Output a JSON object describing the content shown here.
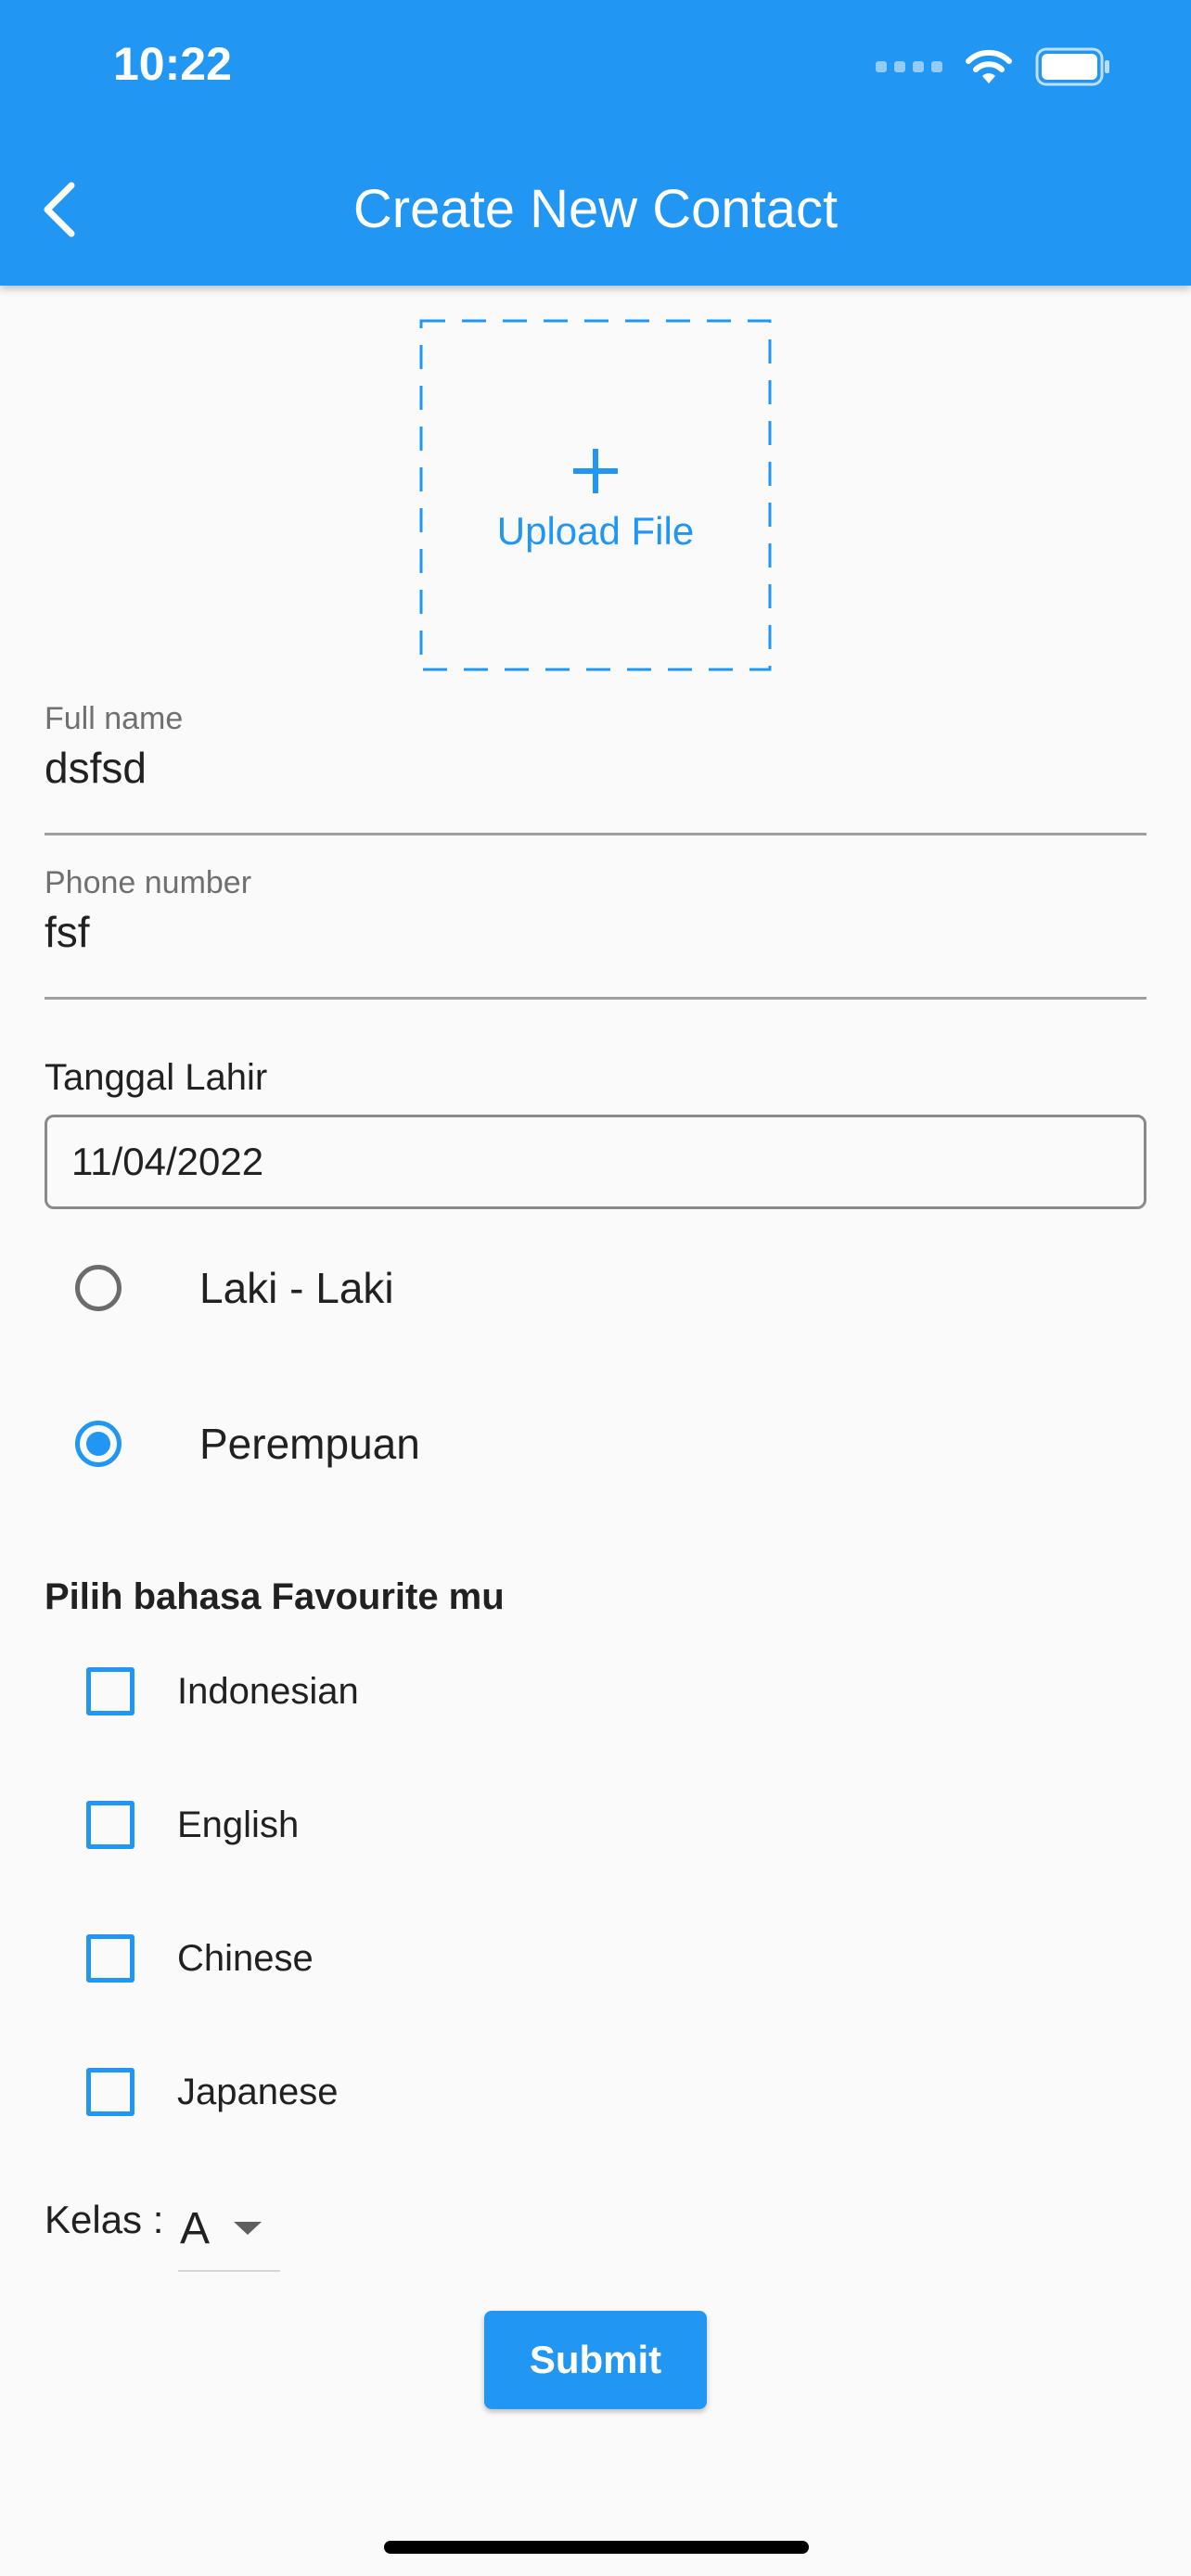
{
  "status_bar": {
    "time": "10:22",
    "icons": [
      "signal-icon",
      "wifi-icon",
      "battery-icon"
    ]
  },
  "app_bar": {
    "title": "Create New Contact",
    "back_icon": "chevron-left-icon",
    "color": "#2196F3"
  },
  "upload": {
    "icon": "plus-icon",
    "label": "Upload File"
  },
  "full_name": {
    "label": "Full name",
    "value": "dsfsd"
  },
  "phone_number": {
    "label": "Phone number",
    "value": "fsf"
  },
  "birth_date": {
    "label": "Tanggal Lahir",
    "value": "11/04/2022"
  },
  "gender": {
    "options": [
      {
        "label": "Laki - Laki",
        "selected": false
      },
      {
        "label": "Perempuan",
        "selected": true
      }
    ]
  },
  "languages": {
    "heading": "Pilih bahasa Favourite mu",
    "options": [
      {
        "label": "Indonesian",
        "checked": false
      },
      {
        "label": "English",
        "checked": false
      },
      {
        "label": "Chinese",
        "checked": false
      },
      {
        "label": "Japanese",
        "checked": false
      }
    ]
  },
  "kelas": {
    "label": "Kelas :",
    "selected": "A",
    "arrow_icon": "caret-down-icon"
  },
  "submit": {
    "label": "Submit"
  },
  "colors": {
    "accent": "#2196F3",
    "background": "#FAFAFA"
  }
}
